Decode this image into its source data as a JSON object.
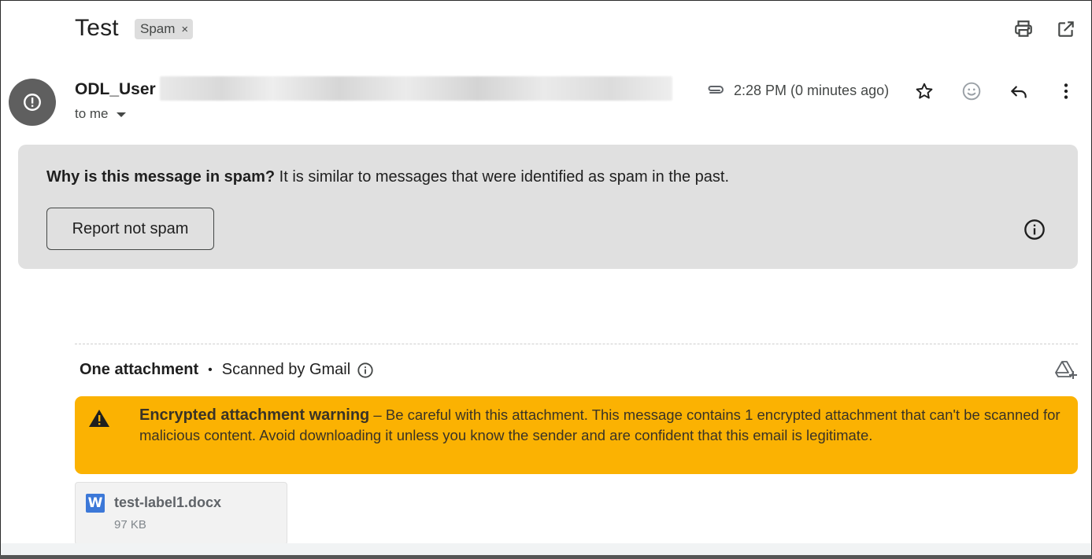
{
  "message": {
    "subject": "Test",
    "label": "Spam",
    "label_remove": "×",
    "sender_name": "ODL_User",
    "recipient": "to me",
    "time": "2:28 PM (0 minutes ago)"
  },
  "toolbar": {
    "print_icon": "print-icon",
    "open_new_window_icon": "open-in-new-window-icon"
  },
  "actions": {
    "attachment_icon": "paperclip-icon",
    "star_icon": "star-icon",
    "emoji_icon": "emoji-reaction-icon",
    "reply_icon": "reply-icon",
    "more_icon": "more-vertical-icon"
  },
  "spam_banner": {
    "question": "Why is this message in spam?",
    "explanation": " It is similar to messages that were identified as spam in the past.",
    "report_button": "Report not spam"
  },
  "attachments": {
    "count_label": "One attachment",
    "separator": "•",
    "scan_label": "Scanned by Gmail",
    "warning_title": "Encrypted attachment warning",
    "warning_body": " – Be careful with this attachment. This message contains 1 encrypted attachment that can't be scanned for malicious content. Avoid downloading it unless you know the sender and are confident that this email is legitimate.",
    "files": [
      {
        "icon_letter": "W",
        "name": "test-label1.docx",
        "size": "97 KB"
      }
    ]
  },
  "colors": {
    "warning_bg": "#fbb202",
    "spam_banner_bg": "#e0e0e0",
    "avatar_bg": "#5f5f5f",
    "word_blue": "#3c78d8"
  }
}
